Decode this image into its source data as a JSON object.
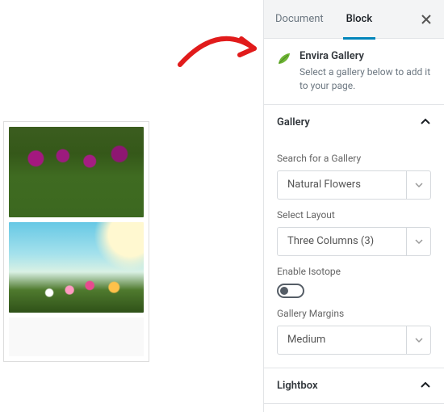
{
  "tabs": {
    "document": "Document",
    "block": "Block"
  },
  "block_header": {
    "title": "Envira Gallery",
    "description": "Select a gallery below to add it to your page."
  },
  "panels": {
    "gallery": {
      "title": "Gallery",
      "fields": {
        "search_label": "Search for a Gallery",
        "search_value": "Natural Flowers",
        "layout_label": "Select Layout",
        "layout_value": "Three Columns (3)",
        "isotope_label": "Enable Isotope",
        "margins_label": "Gallery Margins",
        "margins_value": "Medium"
      }
    },
    "lightbox": {
      "title": "Lightbox"
    }
  },
  "icons": {
    "close": "close",
    "chevron_up": "chevron-up",
    "chevron_down": "chevron-down",
    "leaf": "leaf"
  },
  "colors": {
    "accent": "#0085ba",
    "arrow": "#e11b1b"
  }
}
